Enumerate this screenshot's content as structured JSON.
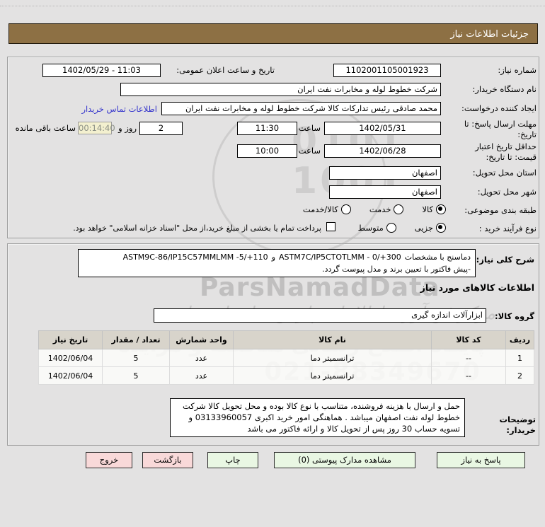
{
  "title_bar": {
    "label": "جزئیات اطلاعات نیاز"
  },
  "form": {
    "need_number": {
      "label": "شماره نیاز:",
      "value": "1102001105001923"
    },
    "announce": {
      "label": "تاریخ و ساعت اعلان عمومی:",
      "value": "1402/05/29 - 11:03"
    },
    "buyer_org": {
      "label": "نام دستگاه خریدار:",
      "value": "شرکت خطوط لوله و مخابرات نفت ایران"
    },
    "creator": {
      "label": "ایجاد کننده درخواست:",
      "value": "محمد صادقی رئیس تدارکات کالا  شرکت خطوط لوله و مخابرات نفت ایران",
      "contact_link": "اطلاعات تماس خریدار"
    },
    "deadline": {
      "label": "مهلت ارسال پاسخ: تا تاریخ:",
      "date": "1402/05/31",
      "hour_label": "ساعت",
      "time": "11:30",
      "days": "2",
      "days_label": "روز و",
      "countdown": "00:14:40",
      "remaining_label": "ساعت باقی مانده"
    },
    "validity": {
      "label": "حداقل تاریخ اعتبار قیمت: تا تاریخ:",
      "date": "1402/06/28",
      "hour_label": "ساعت",
      "time": "10:00"
    },
    "province": {
      "label": "استان محل تحویل:",
      "value": "اصفهان"
    },
    "city": {
      "label": "شهر محل تحویل:",
      "value": "اصفهان"
    },
    "classification": {
      "label": "طبقه بندی موضوعی:",
      "options": [
        {
          "label": "کالا",
          "selected": true
        },
        {
          "label": "خدمت",
          "selected": false
        },
        {
          "label": "کالا/خدمت",
          "selected": false
        }
      ]
    },
    "process": {
      "label": "نوع فرآیند خرید :",
      "options": [
        {
          "label": "جزیی",
          "selected": true
        },
        {
          "label": "متوسط",
          "selected": false
        }
      ],
      "treasury_note": "پرداخت تمام یا بخشی از مبلغ خرید،از محل \"اسناد خزانه اسلامی\" خواهد بود."
    }
  },
  "description": {
    "label": "شرح کلی نیاز:",
    "intro": "دماسنج با مشخصات",
    "spec1": "ASTM7C/IP5CTOTLMM - 0/+300",
    "conjunction": "و",
    "spec2": "ASTM9C-86/IP15C57MMLMM  -5/+110",
    "line2": "-پیش فاکتور با تعیین برند و مدل پیوست گردد."
  },
  "goods": {
    "section_title": "اطلاعات کالاهای مورد نیاز",
    "group": {
      "label": "گروه کالا:",
      "value": "ابزارآلات اندازه گیری"
    },
    "table": {
      "headers": [
        "ردیف",
        "کد کالا",
        "نام کالا",
        "واحد شمارش",
        "تعداد / مقدار",
        "تاریخ نیاز"
      ],
      "rows": [
        {
          "row": "1",
          "code": "--",
          "name": "ترانسمیتر دما",
          "unit": "عدد",
          "qty": "5",
          "date": "1402/06/04"
        },
        {
          "row": "2",
          "code": "--",
          "name": "ترانسمیتر دما",
          "unit": "عدد",
          "qty": "5",
          "date": "1402/06/04"
        }
      ]
    }
  },
  "notes": {
    "label": "توضیحات خریدار:",
    "text": "حمل و ارسال  با هزینه فروشنده، متناسب با نوع کالا بوده و محل تحویل کالا شرکت خطوط لوله نفت اصفهان میباشد . هماهنگی امور خرید اکبری 03133960057 و تسویه حساب 30 روز پس از تحویل کالا و ارائه فاکتور می باشد"
  },
  "buttons": {
    "reply": "پاسخ به نیاز",
    "attachments": "مشاهده مدارک پیوستی (0)",
    "print": "چاپ",
    "back": "بازگشت",
    "exit": "خروج"
  },
  "watermark": {
    "brand": "ParsNamadData",
    "line_fa": "مرکز فن آوری اطلاعات پارس نماد داده ها",
    "line2_fa": "پایگاه اطلاع رسانی مناقصه و مزایده",
    "phone": "021-88349670",
    "digits1": "0101",
    "digits2": "1001"
  },
  "colors": {
    "header_brown": "#8d7044",
    "link_blue": "#3333cc",
    "btn_green": "#e9f7e3",
    "btn_pink": "#f9d9d9",
    "countdown_bg": "#f3f0cf"
  }
}
